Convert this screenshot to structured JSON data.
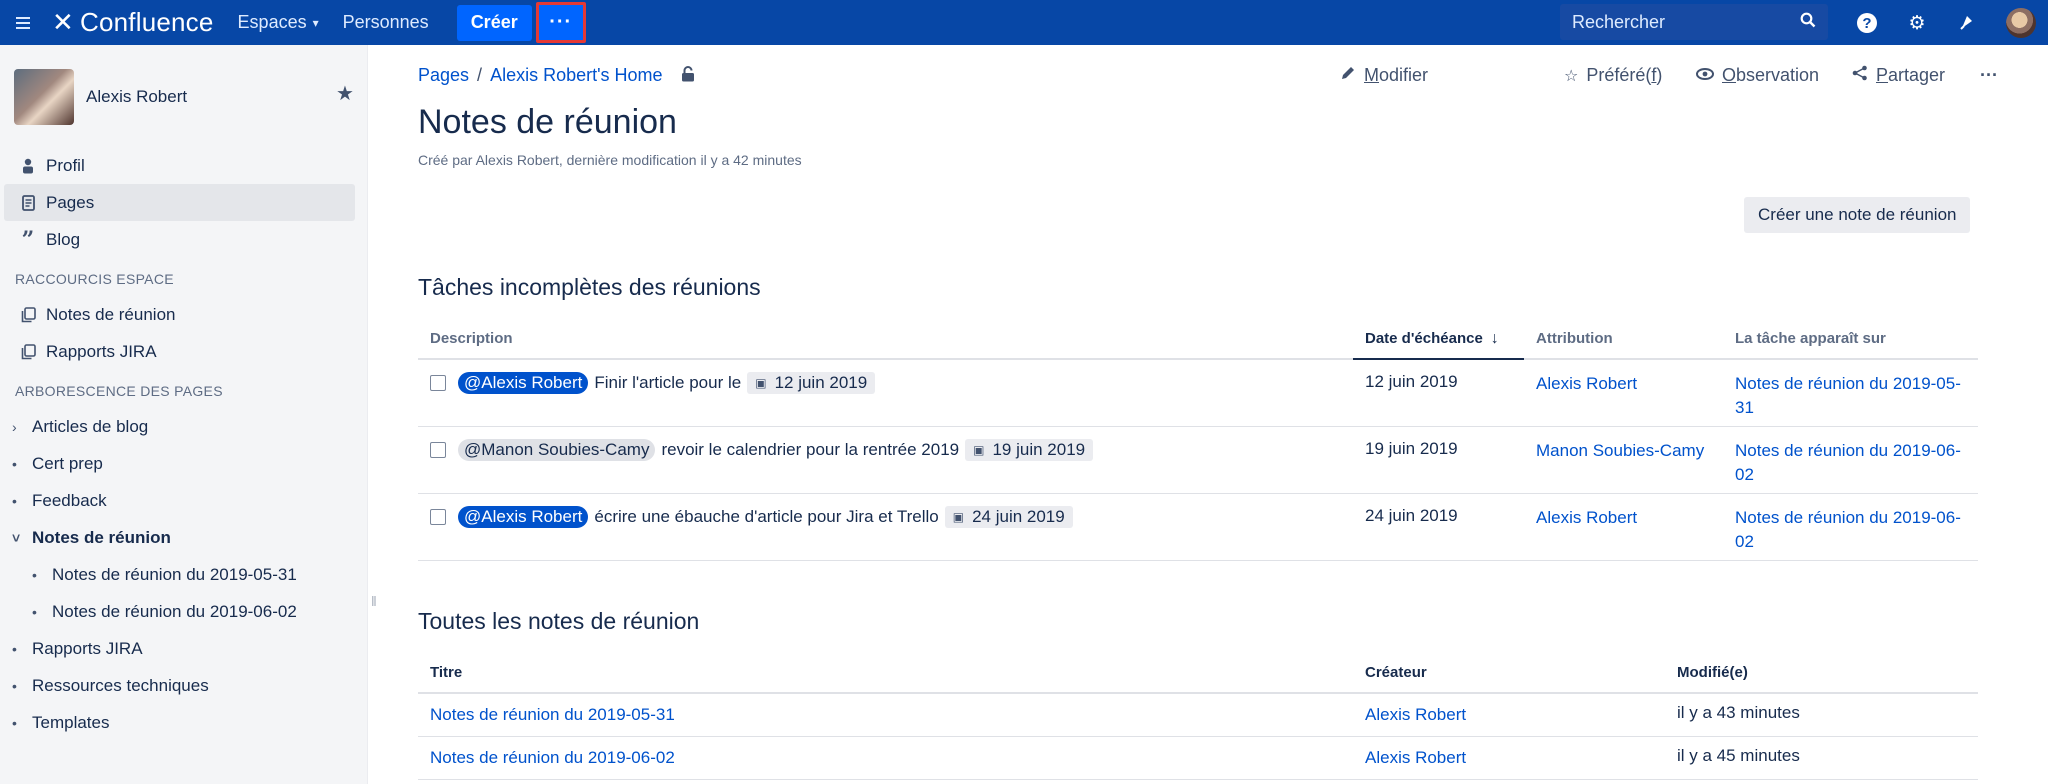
{
  "topbar": {
    "brand": "Confluence",
    "nav": [
      {
        "label": "Espaces",
        "caret": "▾"
      },
      {
        "label": "Personnes"
      }
    ],
    "create_label": "Créer",
    "more_label": "···",
    "search_placeholder": "Rechercher"
  },
  "sidebar": {
    "user_name": "Alexis Robert",
    "items": [
      {
        "label": "Profil",
        "icon": "person-icon"
      },
      {
        "label": "Pages",
        "icon": "page-icon",
        "active": true
      },
      {
        "label": "Blog",
        "icon": "quote-icon"
      }
    ],
    "shortcuts_header": "RACCOURCIS ESPACE",
    "shortcuts": [
      {
        "label": "Notes de réunion"
      },
      {
        "label": "Rapports JIRA"
      }
    ],
    "tree_header": "ARBORESCENCE DES PAGES",
    "tree": [
      {
        "label": "Articles de blog",
        "marker": "›"
      },
      {
        "label": "Cert prep",
        "marker": "•"
      },
      {
        "label": "Feedback",
        "marker": "•"
      },
      {
        "label": "Notes de réunion",
        "marker": "˅"
      },
      {
        "label": "Notes de réunion du 2019-05-31",
        "marker": "•"
      },
      {
        "label": "Notes de réunion du 2019-06-02",
        "marker": "•"
      },
      {
        "label": "Rapports JIRA",
        "marker": "•"
      },
      {
        "label": "Ressources techniques",
        "marker": "•"
      },
      {
        "label": "Templates",
        "marker": "•"
      }
    ]
  },
  "page": {
    "breadcrumb": [
      "Pages",
      "Alexis Robert's Home"
    ],
    "actions": {
      "edit_rest": "odifier",
      "edit_u": "M",
      "fav_pre": "Préféré(",
      "fav_u": "f",
      "fav_post": ")",
      "watch_u": "O",
      "watch_rest": "bservation",
      "share_u": "P",
      "share_rest": "artager",
      "more": "···"
    },
    "title": "Notes de réunion",
    "byline": "Créé par Alexis Robert, dernière modification il y a 42 minutes",
    "create_note_button": "Créer une note de réunion"
  },
  "tasks": {
    "title": "Tâches incomplètes des réunions",
    "headers": [
      "Description",
      "Date d'échéance",
      "Attribution",
      "La tâche apparaît sur"
    ],
    "rows": [
      {
        "mention": "@Alexis Robert",
        "text": "Finir l'article pour le",
        "date_lozenge": "12 juin 2019",
        "due": "12 juin 2019",
        "assignee": "Alexis Robert",
        "appears_on": "Notes de réunion du 2019-05-31"
      },
      {
        "mention": "@Manon Soubies-Camy",
        "text": "revoir le calendrier pour la rentrée 2019",
        "date_lozenge": "19 juin 2019",
        "due": "19 juin 2019",
        "assignee": "Manon Soubies-Camy",
        "appears_on": "Notes de réunion du 2019-06-02"
      },
      {
        "mention": "@Alexis Robert",
        "text": "écrire une ébauche d'article pour Jira et Trello",
        "date_lozenge": "24 juin 2019",
        "due": "24 juin 2019",
        "assignee": "Alexis Robert",
        "appears_on": "Notes de réunion du 2019-06-02"
      }
    ]
  },
  "notes": {
    "title": "Toutes les notes de réunion",
    "headers": [
      "Titre",
      "Créateur",
      "Modifié(e)"
    ],
    "rows": [
      {
        "title": "Notes de réunion du 2019-05-31",
        "creator": "Alexis Robert",
        "modified": "il y a 43 minutes"
      },
      {
        "title": "Notes de réunion du 2019-06-02",
        "creator": "Alexis Robert",
        "modified": "il y a 45 minutes"
      }
    ]
  },
  "colors": {
    "nav_bg": "#0747a6",
    "link": "#0052cc",
    "create": "#0065ff",
    "highlight_border": "#e53935"
  }
}
